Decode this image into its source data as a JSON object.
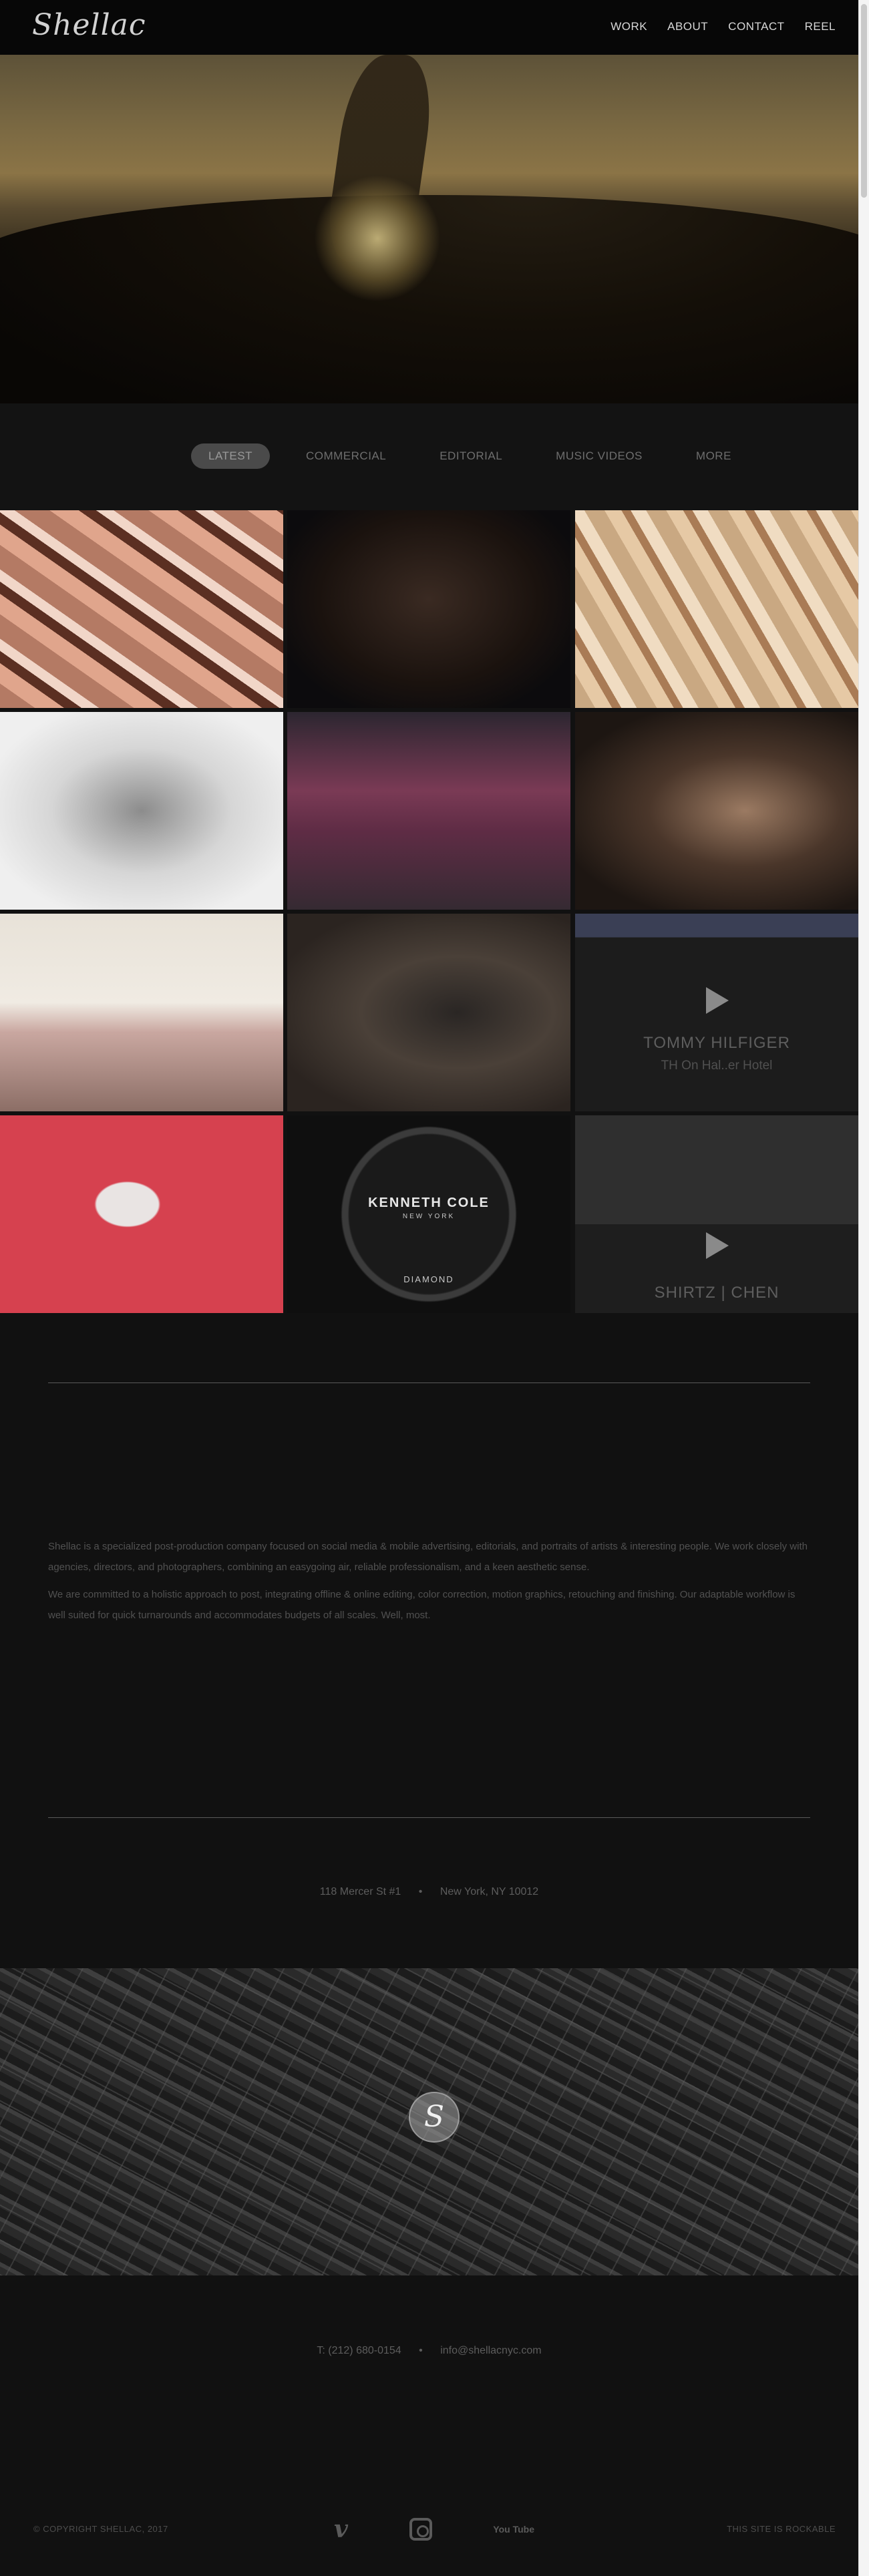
{
  "header": {
    "logo": "Shellac",
    "nav": [
      "WORK",
      "ABOUT",
      "CONTACT",
      "REEL"
    ]
  },
  "filters": [
    "LATEST",
    "COMMERCIAL",
    "EDITORIAL",
    "MUSIC VIDEOS",
    "MORE"
  ],
  "grid": {
    "tommy": {
      "title": "TOMMY HILFIGER",
      "subtitle": "TH On Hal..er Hotel"
    },
    "shirtz": {
      "title": "SHIRTZ | CHEN"
    },
    "watch": {
      "brand": "KENNETH COLE",
      "sub": "NEW YORK",
      "model": "DIAMOND"
    }
  },
  "about": {
    "p1": "Shellac is a specialized post-production company focused on social media & mobile advertising, editorials, and portraits of artists & interesting people. We work closely with agencies, directors, and photographers, combining an easygoing air, reliable professionalism, and a keen aesthetic sense.",
    "p2": "We are committed to a holistic approach to post, integrating offline & online editing, color correction, motion graphics, retouching and finishing. Our adaptable workflow is well suited for quick turnarounds and accommodates budgets of all scales. Well, most."
  },
  "address": {
    "street": "118 Mercer St #1",
    "city": "New York, NY 10012"
  },
  "map": {
    "pin": "S"
  },
  "contact": {
    "phone": "T: (212) 680-0154",
    "email": "info@shellacnyc.com"
  },
  "footer": {
    "copyright": "© COPYRIGHT SHELLAC, 2017",
    "tagline": "THIS SITE IS ROCKABLE",
    "youtube_label": "You Tube"
  },
  "colors": {
    "background": "#111111",
    "header": "#070707",
    "active_filter": "#4a4a4a"
  }
}
